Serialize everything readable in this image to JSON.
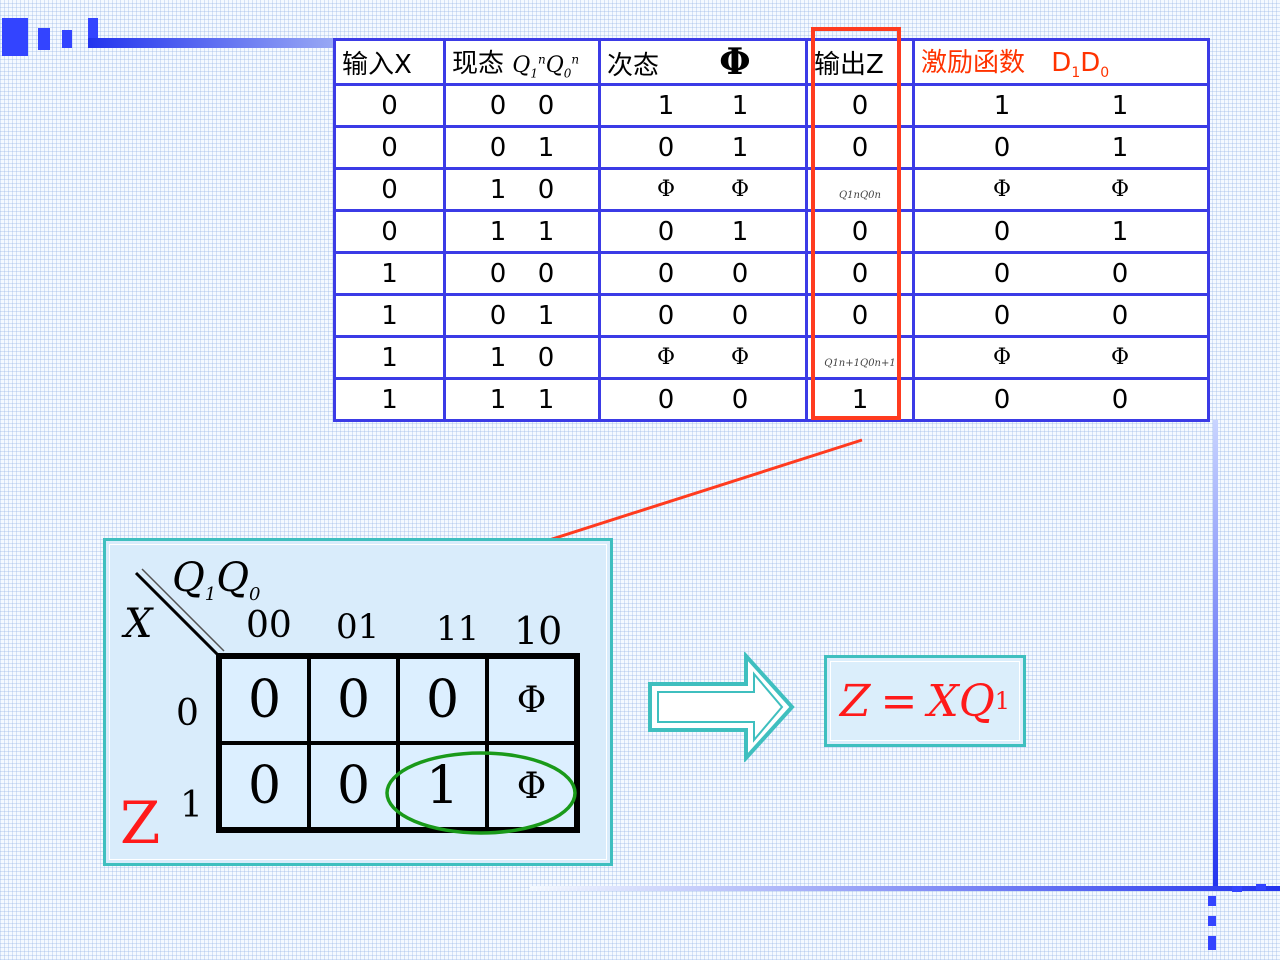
{
  "table": {
    "headers": {
      "input_x": "输入X",
      "current_state": "现态",
      "current_state_vars": "Q1nQ0n",
      "next_state": "次态",
      "next_state_symbol": "Φ",
      "output_z": "输出Z",
      "excitation": "激励函数",
      "excitation_vars": "D1D0"
    },
    "rows": [
      {
        "x": "0",
        "q1": "0",
        "q0": "0",
        "n1": "1",
        "n0": "1",
        "z": "0",
        "d1": "1",
        "d0": "1"
      },
      {
        "x": "0",
        "q1": "0",
        "q0": "1",
        "n1": "0",
        "n0": "1",
        "z": "0",
        "d1": "0",
        "d0": "1"
      },
      {
        "x": "0",
        "q1": "1",
        "q0": "0",
        "n1": "Φ",
        "n0": "Φ",
        "z": "Q1nQ0n",
        "d1": "Φ",
        "d0": "Φ"
      },
      {
        "x": "0",
        "q1": "1",
        "q0": "1",
        "n1": "0",
        "n0": "1",
        "z": "0",
        "d1": "0",
        "d0": "1"
      },
      {
        "x": "1",
        "q1": "0",
        "q0": "0",
        "n1": "0",
        "n0": "0",
        "z": "0",
        "d1": "0",
        "d0": "0"
      },
      {
        "x": "1",
        "q1": "0",
        "q0": "1",
        "n1": "0",
        "n0": "0",
        "z": "0",
        "d1": "0",
        "d0": "0"
      },
      {
        "x": "1",
        "q1": "1",
        "q0": "0",
        "n1": "Φ",
        "n0": "Φ",
        "z": "Q1n+1Q0n+1",
        "d1": "Φ",
        "d0": "Φ"
      },
      {
        "x": "1",
        "q1": "1",
        "q0": "1",
        "n1": "0",
        "n0": "0",
        "z": "1",
        "d1": "0",
        "d0": "0"
      }
    ]
  },
  "kmap": {
    "label_z": "Z",
    "row_var": "X",
    "col_vars": "Q1Q0",
    "col_headers": [
      "00",
      "01",
      "11",
      "10"
    ],
    "row_headers": [
      "0",
      "1"
    ],
    "cells": [
      [
        "0",
        "0",
        "0",
        "Φ"
      ],
      [
        "0",
        "0",
        "1",
        "Φ"
      ]
    ]
  },
  "result": {
    "lhs": "Z",
    "equals": "=",
    "rhs_main": "XQ",
    "rhs_sub": "1"
  },
  "colors": {
    "table_border": "#3b3be6",
    "highlight": "#ff3b1f",
    "excitation_header": "#ff3300",
    "kmap_border": "#3fbfbf",
    "group_ellipse": "#1a9a1a",
    "result_text": "#ff1a1a",
    "arrow": "#ff3b1f"
  }
}
